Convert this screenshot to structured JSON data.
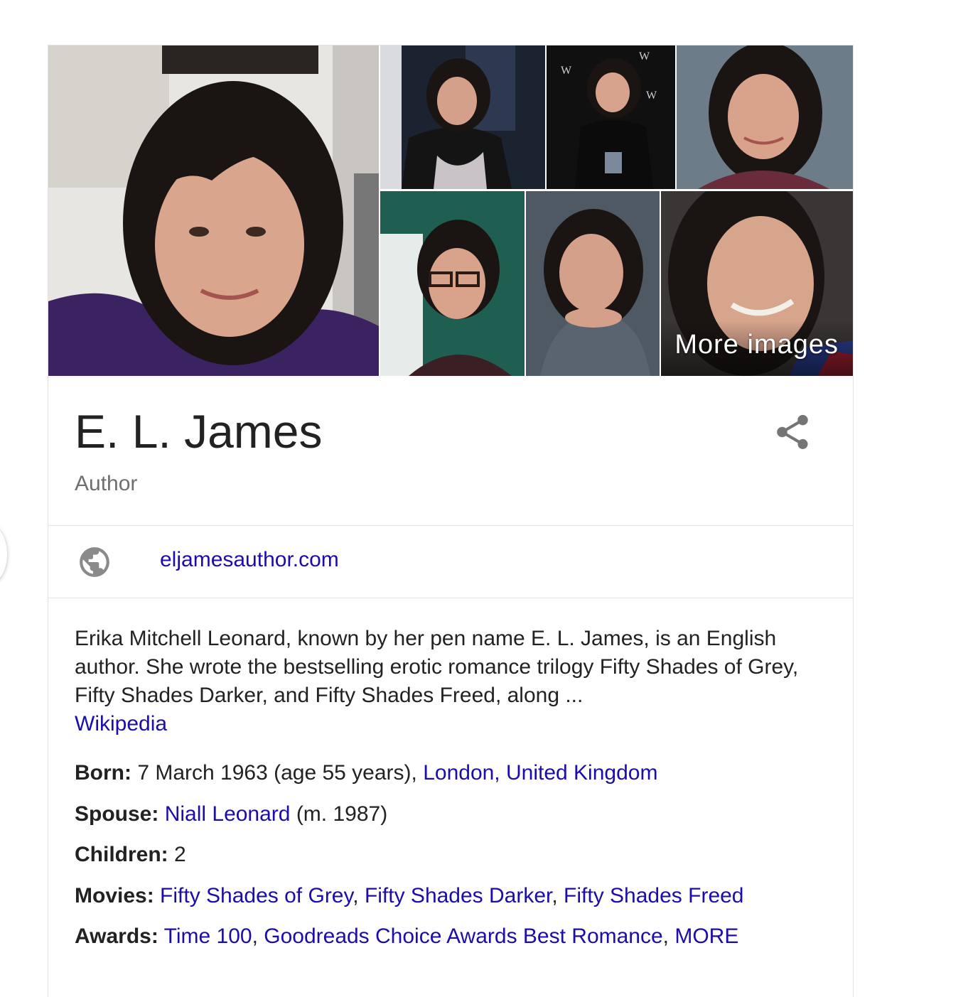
{
  "gallery": {
    "more_images_label": "More images"
  },
  "entity": {
    "name": "E. L. James",
    "type": "Author"
  },
  "website": {
    "label": "eljamesauthor.com"
  },
  "description": {
    "text": "Erika Mitchell Leonard, known by her pen name E. L. James, is an English author. She wrote the bestselling erotic romance trilogy Fifty Shades of Grey, Fifty Shades Darker, and Fifty Shades Freed, along ...",
    "source": "Wikipedia"
  },
  "facts": {
    "born": {
      "label": "Born:",
      "value": " 7 March 1963 (age 55 years), ",
      "link": "London, United Kingdom"
    },
    "spouse": {
      "label": "Spouse:",
      "link": "Niall Leonard",
      "suffix": " (m. 1987)"
    },
    "children": {
      "label": "Children:",
      "value": " 2"
    },
    "movies": {
      "label": "Movies:",
      "links": [
        "Fifty Shades of Grey",
        "Fifty Shades Darker",
        "Fifty Shades Freed"
      ],
      "separator": ", "
    },
    "awards": {
      "label": "Awards:",
      "links": [
        "Time 100",
        "Goodreads Choice Awards Best Romance",
        "MORE"
      ],
      "separator": ", "
    }
  },
  "colors": {
    "link": "#1a0dab",
    "text": "#222222",
    "muted": "#6f6f6f",
    "divider": "#e4e4e4"
  },
  "icons": {
    "share": "share-icon",
    "globe": "globe-icon"
  }
}
